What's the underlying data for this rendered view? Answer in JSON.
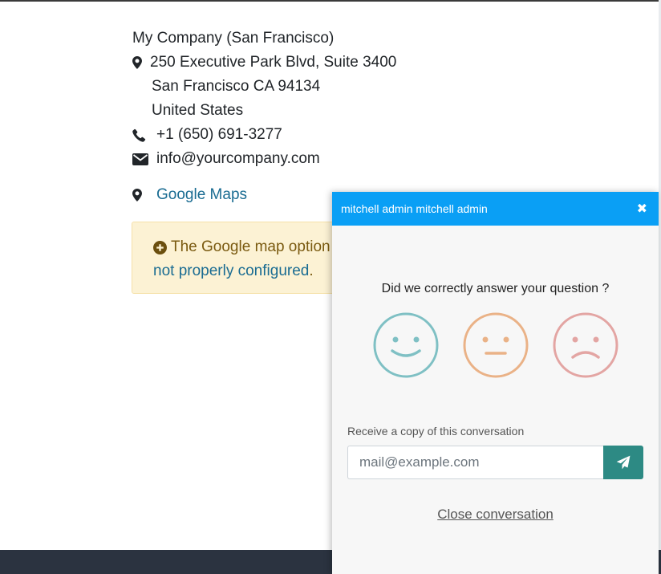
{
  "contact": {
    "company": "My Company (San Francisco)",
    "address_line1": "250 Executive Park Blvd, Suite 3400",
    "address_line2": "San Francisco CA 94134",
    "address_line3": "United States",
    "phone": "+1 (650) 691-3277",
    "email": "info@yourcompany.com",
    "maps_link": "Google Maps"
  },
  "alert": {
    "text": "The Google map option",
    "link_text": "not properly configured",
    "suffix": "."
  },
  "chat": {
    "title": "mitchell admin mitchell admin",
    "close_symbol": "✖",
    "question": "Did we correctly answer your question ?",
    "copy_label": "Receive a copy of this conversation",
    "email_placeholder": "mail@example.com",
    "close_conversation": "Close conversation"
  },
  "icons": {
    "address": "map-marker-icon",
    "phone": "phone-icon",
    "email": "envelope-icon",
    "maps": "map-marker-icon",
    "alert": "plus-circle-icon",
    "send": "paper-plane-icon",
    "ratings": [
      "happy-face-icon",
      "neutral-face-icon",
      "sad-face-icon"
    ]
  },
  "colors": {
    "header": "#0a9ff5",
    "link": "#1a6c92",
    "send_button": "#2d8a84",
    "happy": "#7fc0c4",
    "neutral": "#eab287",
    "sad": "#e3a5a3",
    "alert_bg": "#fcf2d4"
  }
}
